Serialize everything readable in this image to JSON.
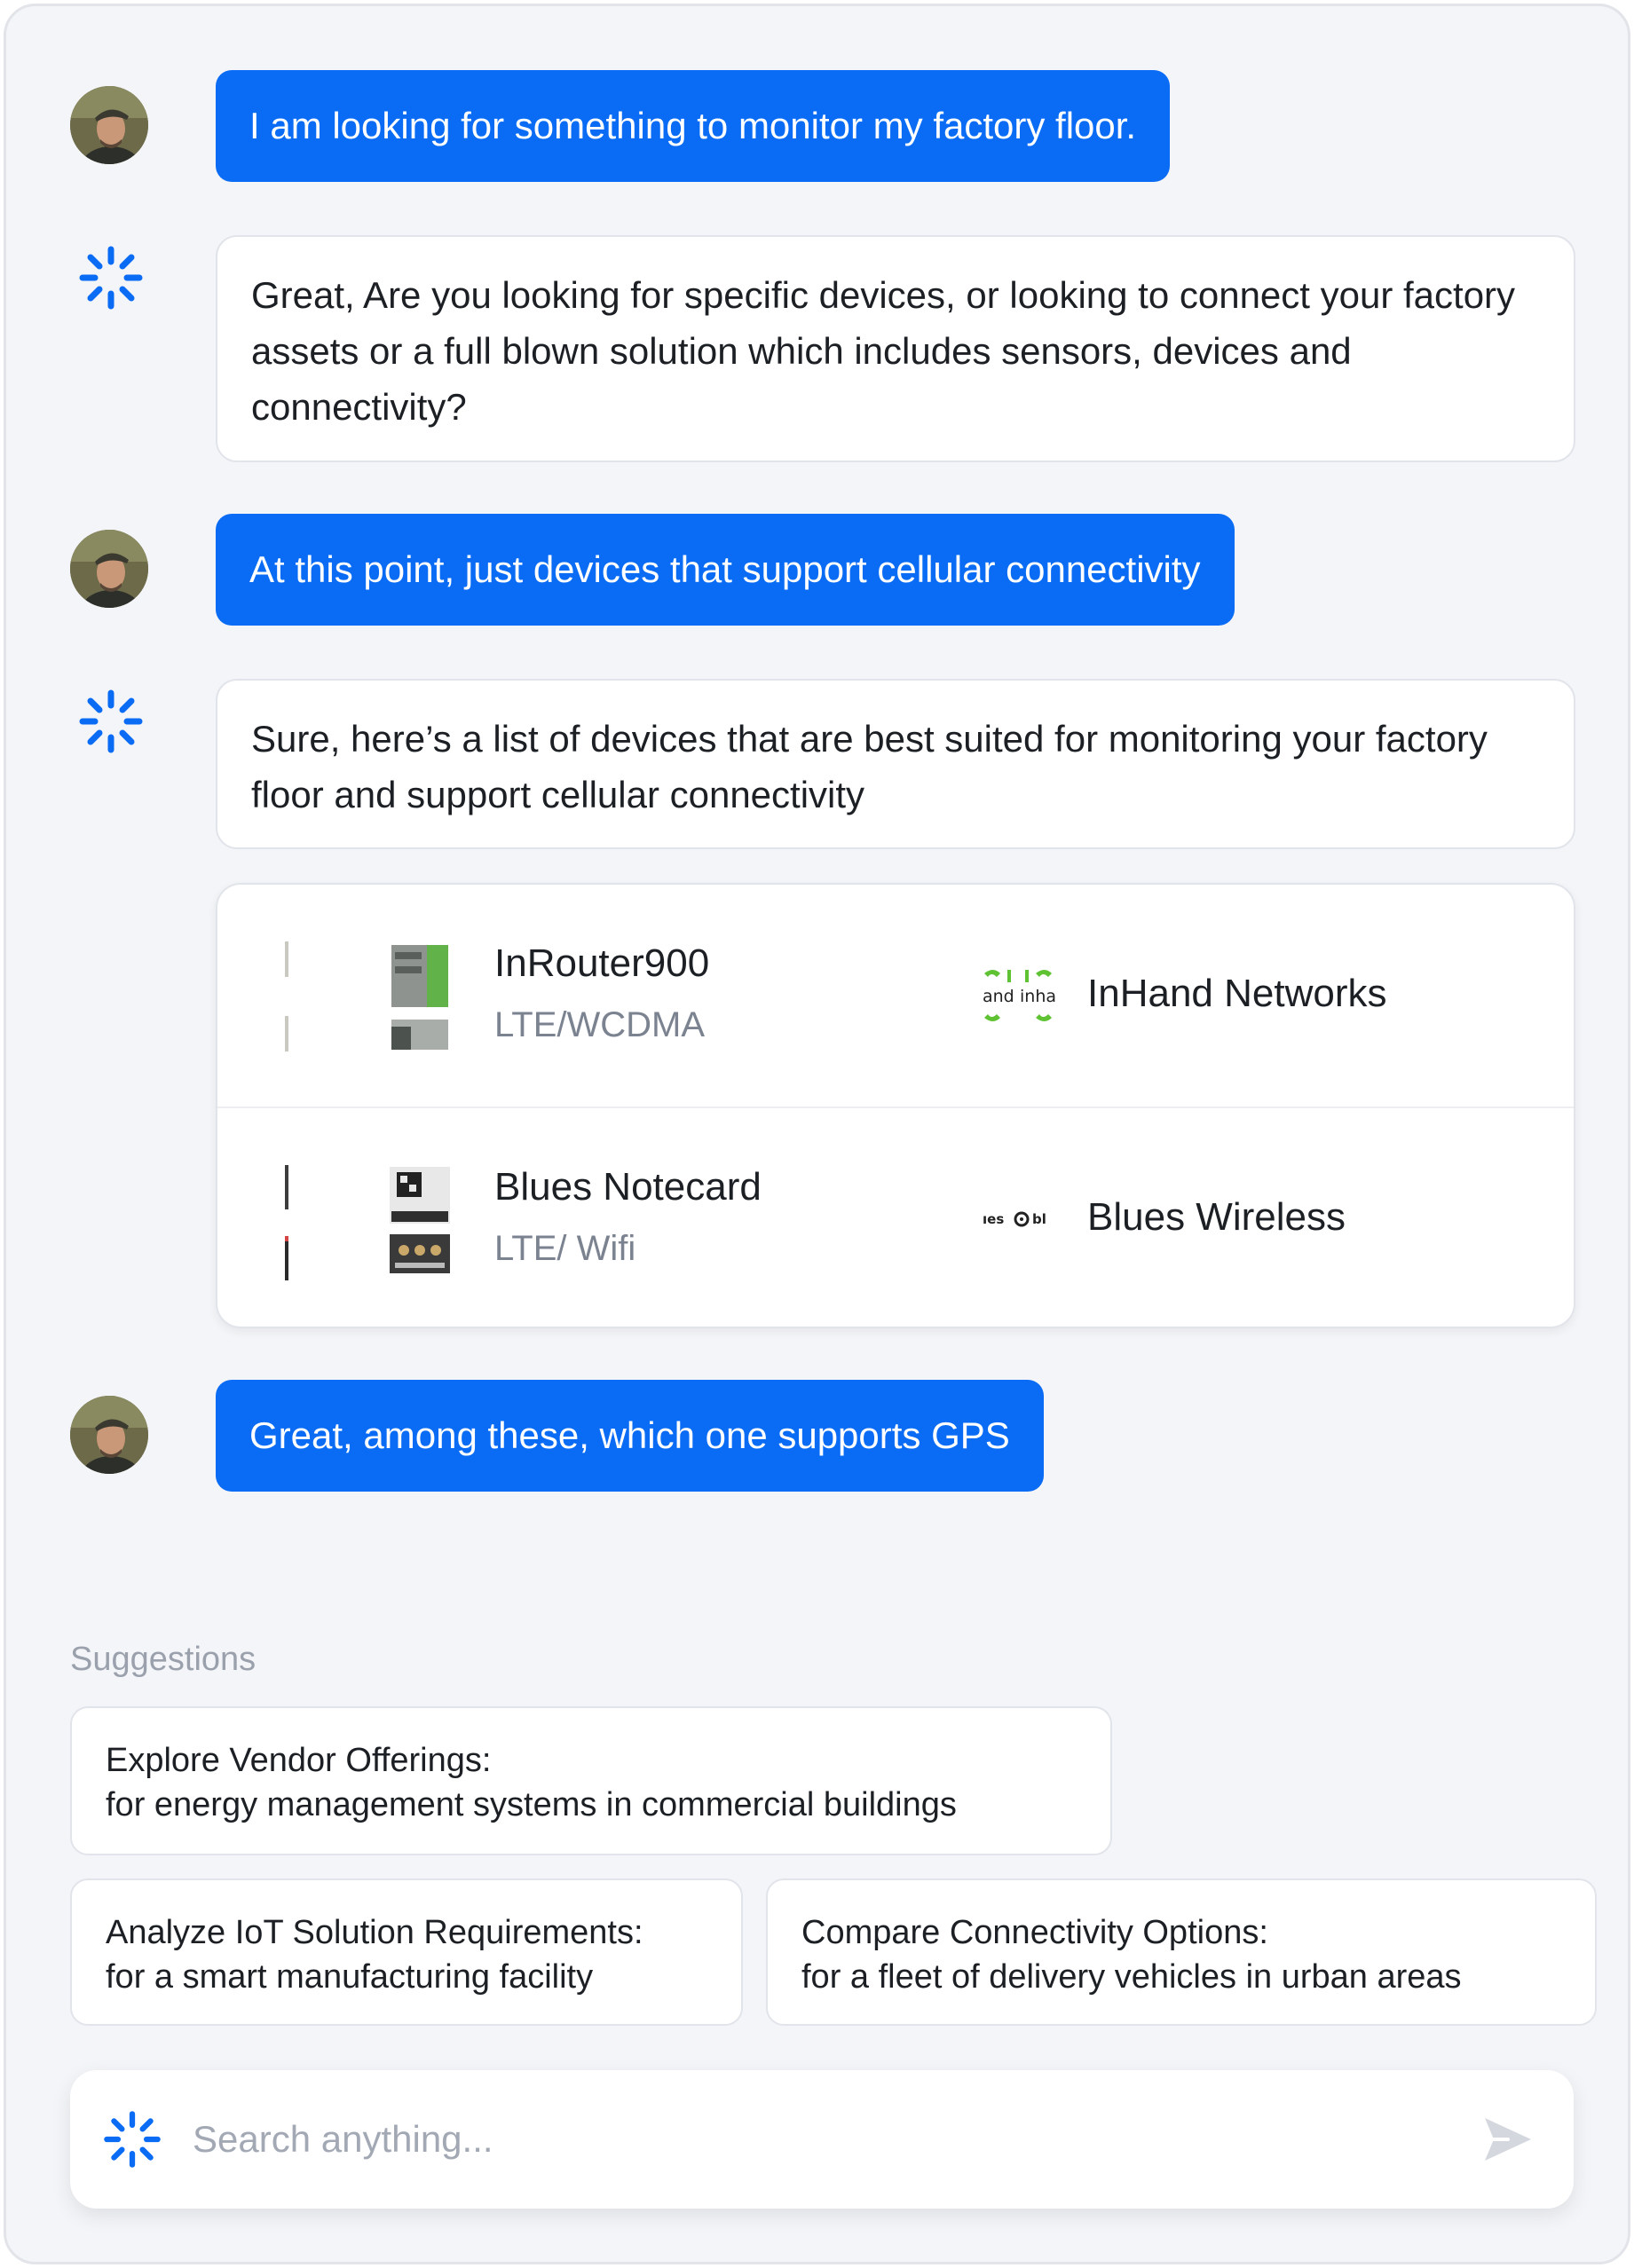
{
  "conversation": {
    "msg1": {
      "sender": "user",
      "text": "I am looking for something to monitor my factory floor."
    },
    "msg2": {
      "sender": "assistant",
      "text": "Great, Are you looking for specific devices, or looking to connect your factory assets or a full blown solution which includes sensors, devices and connectivity?"
    },
    "msg3": {
      "sender": "user",
      "text": "At this point, just devices that support cellular connectivity"
    },
    "msg4": {
      "sender": "assistant",
      "text": "Sure, here’s a list of devices that are best suited for monitoring your factory floor and support cellular connectivity"
    },
    "msg5": {
      "sender": "user",
      "text": "Great, among these, which one supports GPS"
    }
  },
  "devices": [
    {
      "name": "InRouter900",
      "tech": "LTE/WCDMA",
      "vendor": "InHand Networks",
      "vendor_logo": "inhand-logo",
      "accent": "#5ec233"
    },
    {
      "name": "Blues Notecard",
      "tech": "LTE/ Wifi",
      "vendor": "Blues Wireless",
      "vendor_logo": "blues-logo",
      "accent": "#d64545"
    }
  ],
  "suggestions": {
    "label": "Suggestions",
    "items": [
      {
        "title": "Explore Vendor Offerings:",
        "detail": "for energy management systems in commercial buildings"
      },
      {
        "title": "Analyze IoT Solution Requirements:",
        "detail": "for a smart manufacturing facility"
      },
      {
        "title": "Compare Connectivity Options:",
        "detail": "for a fleet of delivery vehicles in urban areas"
      }
    ]
  },
  "search": {
    "placeholder": "Search anything..."
  },
  "icons": {
    "assistant": "spark-icon",
    "send": "send-icon",
    "user": "user-avatar"
  },
  "colors": {
    "accent": "#0a6cf5",
    "background": "#f4f5f8",
    "muted_text": "#7b8290"
  }
}
